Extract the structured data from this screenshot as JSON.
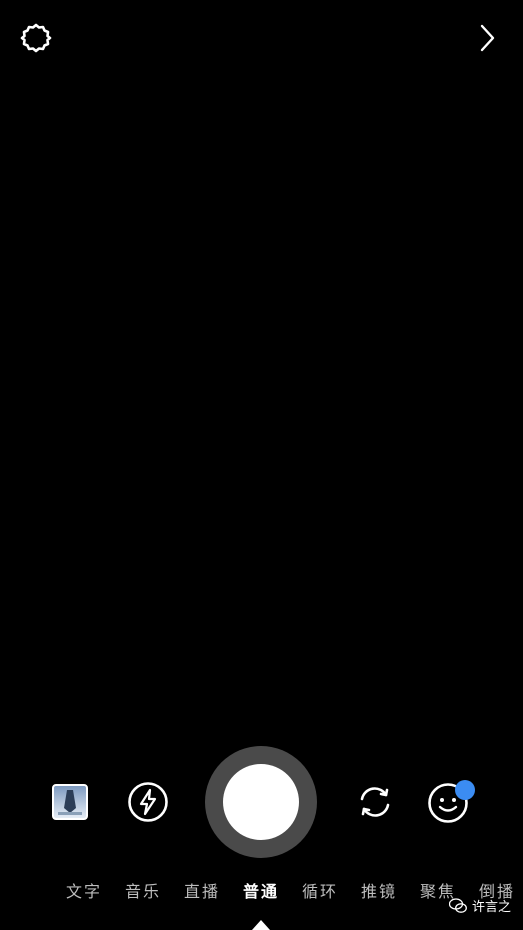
{
  "top_bar": {
    "settings_icon": "gear-icon",
    "next_icon": "chevron-right-icon"
  },
  "controls": {
    "gallery_icon": "gallery-thumbnail",
    "flash_icon": "flash-icon",
    "shutter_icon": "shutter-button",
    "flip_icon": "camera-flip-icon",
    "face_icon": "face-effects-icon",
    "face_badge_color": "#3b8cf2"
  },
  "modes": [
    {
      "label": "文字"
    },
    {
      "label": "音乐"
    },
    {
      "label": "直播"
    },
    {
      "label": "普通"
    },
    {
      "label": "循环"
    },
    {
      "label": "推镜"
    },
    {
      "label": "聚焦"
    },
    {
      "label": "倒播"
    }
  ],
  "active_mode": "普通",
  "watermark": {
    "text": "许言之",
    "icon": "wechat-icon"
  }
}
